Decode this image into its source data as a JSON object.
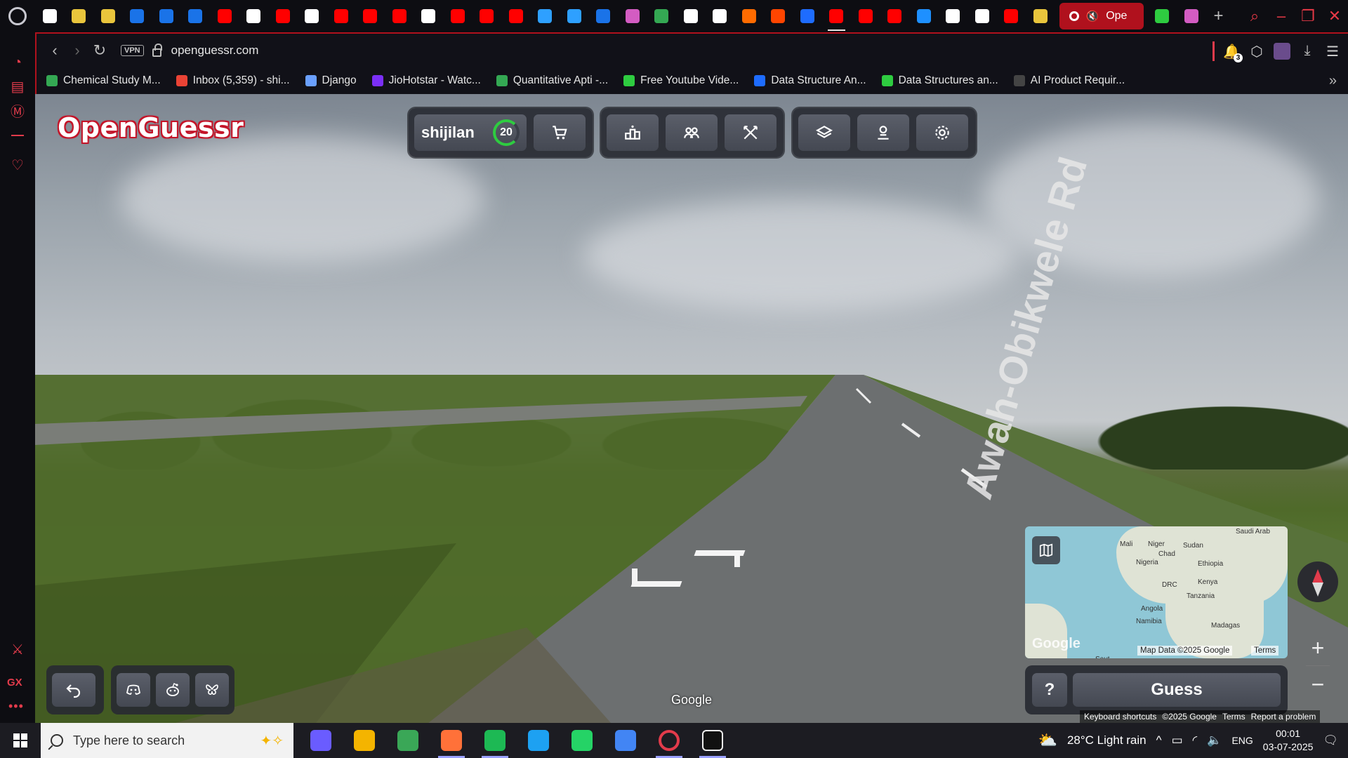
{
  "browser": {
    "url": "openguessr.com",
    "vpn_label": "VPN",
    "active_tab_label": "Ope",
    "tab_icon_colors": [
      "#ffffff",
      "#e9c53c",
      "#e9c53c",
      "#1a73e8",
      "#1a73e8",
      "#1a73e8",
      "#ff0000",
      "#ffffff",
      "#ff0000",
      "#ffffff",
      "#ff0000",
      "#ff0000",
      "#ff0000",
      "#ffffff",
      "#ff0000",
      "#ff0000",
      "#ff0000",
      "#2ea0ff",
      "#2ea0ff",
      "#1a73e8",
      "#d35cc2",
      "#34a853",
      "#ffffff",
      "#ffffff",
      "#ff6b00",
      "#ff4500",
      "#1e6cff",
      "#ff0000",
      "#ff0000",
      "#ff0000",
      "#1e90ff",
      "#ffffff",
      "#ffffff",
      "#ff0000",
      "#e9c53c"
    ],
    "tab_extra_colors": [
      "#2ecc40",
      "#d35cc2"
    ]
  },
  "bookmarks": [
    {
      "label": "Chemical Study M...",
      "color": "#34a853"
    },
    {
      "label": "Inbox (5,359) - shi...",
      "color": "#ea4335"
    },
    {
      "label": "Django",
      "color": "#6aa0ff"
    },
    {
      "label": "JioHotstar - Watc...",
      "color": "#7b2ff7"
    },
    {
      "label": "Quantitative Apti -...",
      "color": "#34a853"
    },
    {
      "label": "Free Youtube Vide...",
      "color": "#2ecc40"
    },
    {
      "label": "Data Structure An...",
      "color": "#1e6cff"
    },
    {
      "label": "Data Structures an...",
      "color": "#2ecc40"
    },
    {
      "label": "AI Product Requir...",
      "color": "#444444"
    }
  ],
  "game": {
    "brand": "OpenGuessr",
    "username": "shijilan",
    "level": "20",
    "guess_label": "Guess",
    "help_label": "?",
    "street_name": "Awah-Obikwele Rd",
    "streetview_watermark": "Google",
    "map": {
      "attribution": "Map Data ©2025 Google",
      "terms": "Terms",
      "logo": "Google",
      "labels": [
        "Saudi Arab",
        "Mali",
        "Niger",
        "Sudan",
        "Chad",
        "Nigeria",
        "Ethiopia",
        "DRC",
        "Kenya",
        "Tanzania",
        "Angola",
        "Namibia",
        "Madagas",
        "Sout"
      ]
    },
    "footer_links": [
      "Keyboard shortcuts",
      "©2025 Google",
      "Terms",
      "Report a problem"
    ],
    "zoom_in": "+",
    "zoom_out": "−"
  },
  "taskbar": {
    "search_placeholder": "Type here to search",
    "weather": "28°C  Light rain",
    "language": "ENG",
    "time": "00:01",
    "date": "03-07-2025",
    "app_colors": [
      "#6a5cff",
      "#f4b400",
      "#3aa757",
      "#ff7139",
      "#1db954",
      "#1da1f2",
      "#25d366",
      "#4285f4",
      "#e23b4b",
      "#ffffff"
    ]
  }
}
